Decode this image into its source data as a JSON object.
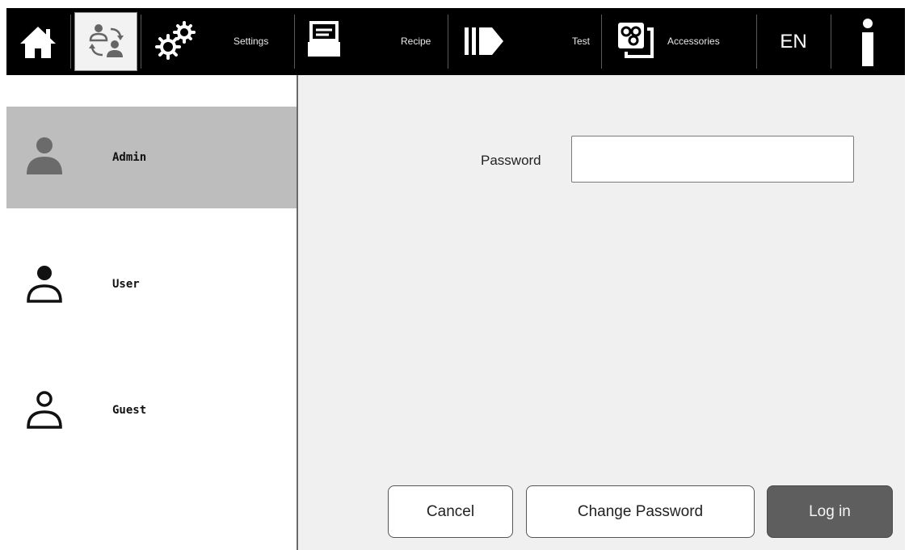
{
  "toolbar": {
    "items": [
      {
        "icon": "home-icon"
      },
      {
        "icon": "user-switch-icon",
        "selected": true
      },
      {
        "icon": "gears-icon",
        "label": "Settings"
      },
      {
        "icon": "recipe-tray-icon",
        "label": "Recipe"
      },
      {
        "icon": "test-arrow-icon",
        "label": "Test"
      },
      {
        "icon": "accessories-icon",
        "label": "Accessories"
      },
      {
        "label": "EN"
      },
      {
        "icon": "info-icon"
      }
    ]
  },
  "users": [
    {
      "label": "Admin",
      "active": true,
      "icon": "admin-avatar-icon"
    },
    {
      "label": "User",
      "active": false,
      "icon": "user-avatar-icon"
    },
    {
      "label": "Guest",
      "active": false,
      "icon": "guest-avatar-icon"
    }
  ],
  "login": {
    "password_label": "Password",
    "password_value": "",
    "cancel_label": "Cancel",
    "change_password_label": "Change Password",
    "login_label": "Log in"
  },
  "colors": {
    "toolbar_bg": "#000000",
    "active_row": "#bdbdbd",
    "panel_bg": "#f0f0f0",
    "login_button": "#5e5e5e"
  }
}
